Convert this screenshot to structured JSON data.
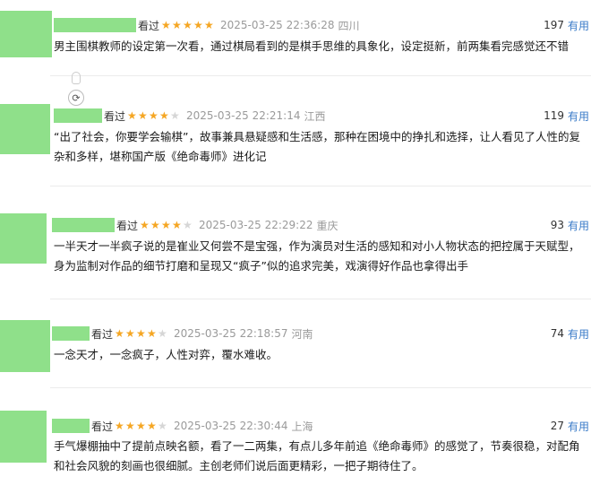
{
  "comments": [
    {
      "status": "看过",
      "stars": 5,
      "time": "2025-03-25 22:36:28",
      "location": "四川",
      "votes": "197",
      "vote_label": "有用",
      "text": "男主围棋教师的设定第一次看，通过棋局看到的是棋手思维的具象化，设定挺新，前两集看完感觉还不错"
    },
    {
      "status": "看过",
      "stars": 4,
      "time": "2025-03-25 22:21:14",
      "location": "江西",
      "votes": "119",
      "vote_label": "有用",
      "text": "“出了社会，你要学会输棋”，故事兼具悬疑感和生活感，那种在困境中的挣扎和选择，让人看见了人性的复杂和多样，堪称国产版《绝命毒师》进化记"
    },
    {
      "status": "看过",
      "stars": 4,
      "time": "2025-03-25 22:29:22",
      "location": "重庆",
      "votes": "93",
      "vote_label": "有用",
      "text": "一半天才一半疯子说的是崔业又何尝不是宝强，作为演员对生活的感知和对小人物状态的把控属于天赋型，身为监制对作品的细节打磨和呈现又“疯子”似的追求完美，戏演得好作品也拿得出手"
    },
    {
      "status": "看过",
      "stars": 4,
      "time": "2025-03-25 22:18:57",
      "location": "河南",
      "votes": "74",
      "vote_label": "有用",
      "text": "一念天才，一念疯子，人性对弈，覆水难收。"
    },
    {
      "status": "看过",
      "stars": 4,
      "time": "2025-03-25 22:30:44",
      "location": "上海",
      "votes": "27",
      "vote_label": "有用",
      "text": "手气爆棚抽中了提前点映名额，看了一二两集，有点儿多年前追《绝命毒师》的感觉了，节奏很稳，对配角和社会风貌的刻画也很细腻。主创老师们说后面更精彩，一把子期待住了。"
    }
  ],
  "colors": {
    "star_on": "#f5a623",
    "star_off": "#d6d6d6",
    "vote_link": "#3a7bc8",
    "redacted": "#8fe08a"
  },
  "icons": [
    "star-icon",
    "refresh-icon",
    "lightbulb-icon"
  ]
}
